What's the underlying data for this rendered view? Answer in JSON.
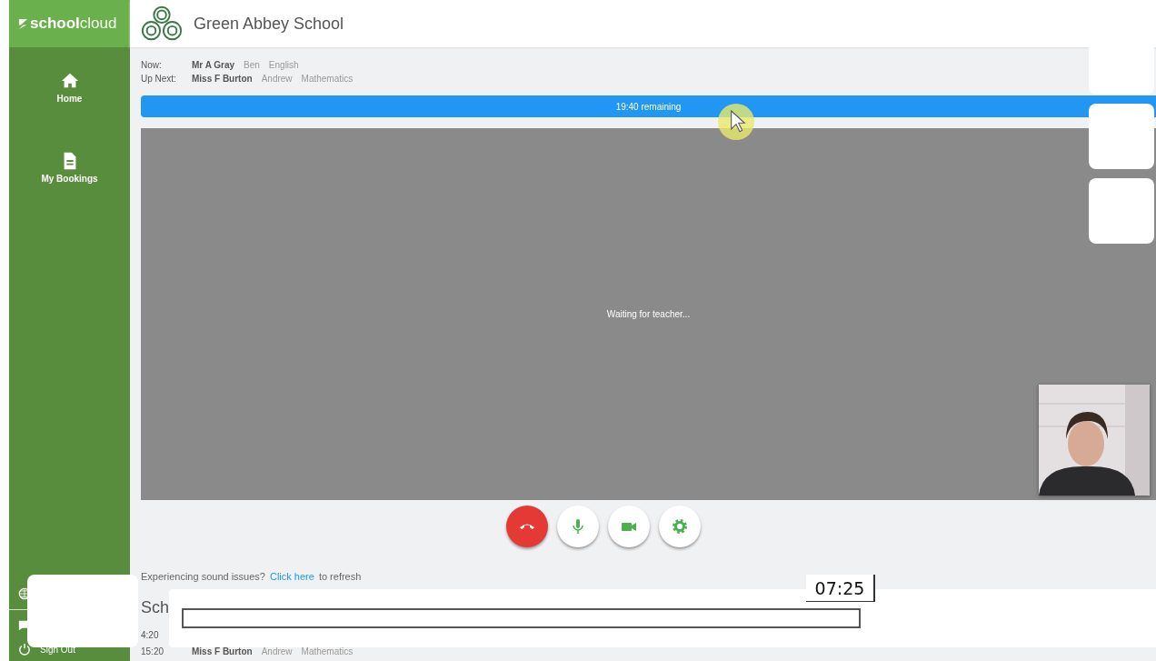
{
  "sidebar": {
    "logo": {
      "bold": "school",
      "light": "cloud"
    },
    "items": [
      {
        "kind": "home",
        "label": "Home"
      },
      {
        "kind": "bookings",
        "label": "My Bookings"
      }
    ],
    "footer_items": [
      {
        "kind": "globe"
      },
      {
        "kind": "chat"
      },
      {
        "kind": "power",
        "label": "Sign Out"
      }
    ]
  },
  "header": {
    "school_name": "Green Abbey School"
  },
  "now": {
    "label": "Now:",
    "teacher": "Mr A Gray",
    "student": "Ben",
    "subject": "English"
  },
  "up_next": {
    "label": "Up Next:",
    "teacher": "Miss F Burton",
    "student": "Andrew",
    "subject": "Mathematics"
  },
  "timer": {
    "text": "19:40 remaining"
  },
  "video": {
    "status": "Waiting for teacher..."
  },
  "call_controls": [
    {
      "kind": "hangup"
    },
    {
      "kind": "mic"
    },
    {
      "kind": "camera"
    },
    {
      "kind": "settings"
    }
  ],
  "sound_notice": {
    "before": "Experiencing sound issues?",
    "link": "Click here",
    "after": "to refresh"
  },
  "schedule": {
    "heading": "Sch",
    "rows": [
      {
        "time": "4:20"
      },
      {
        "time": "15:20",
        "teacher": "Miss F Burton",
        "student": "Andrew",
        "subject": "Mathematics"
      }
    ]
  },
  "player": {
    "tooltip": "07:25"
  }
}
